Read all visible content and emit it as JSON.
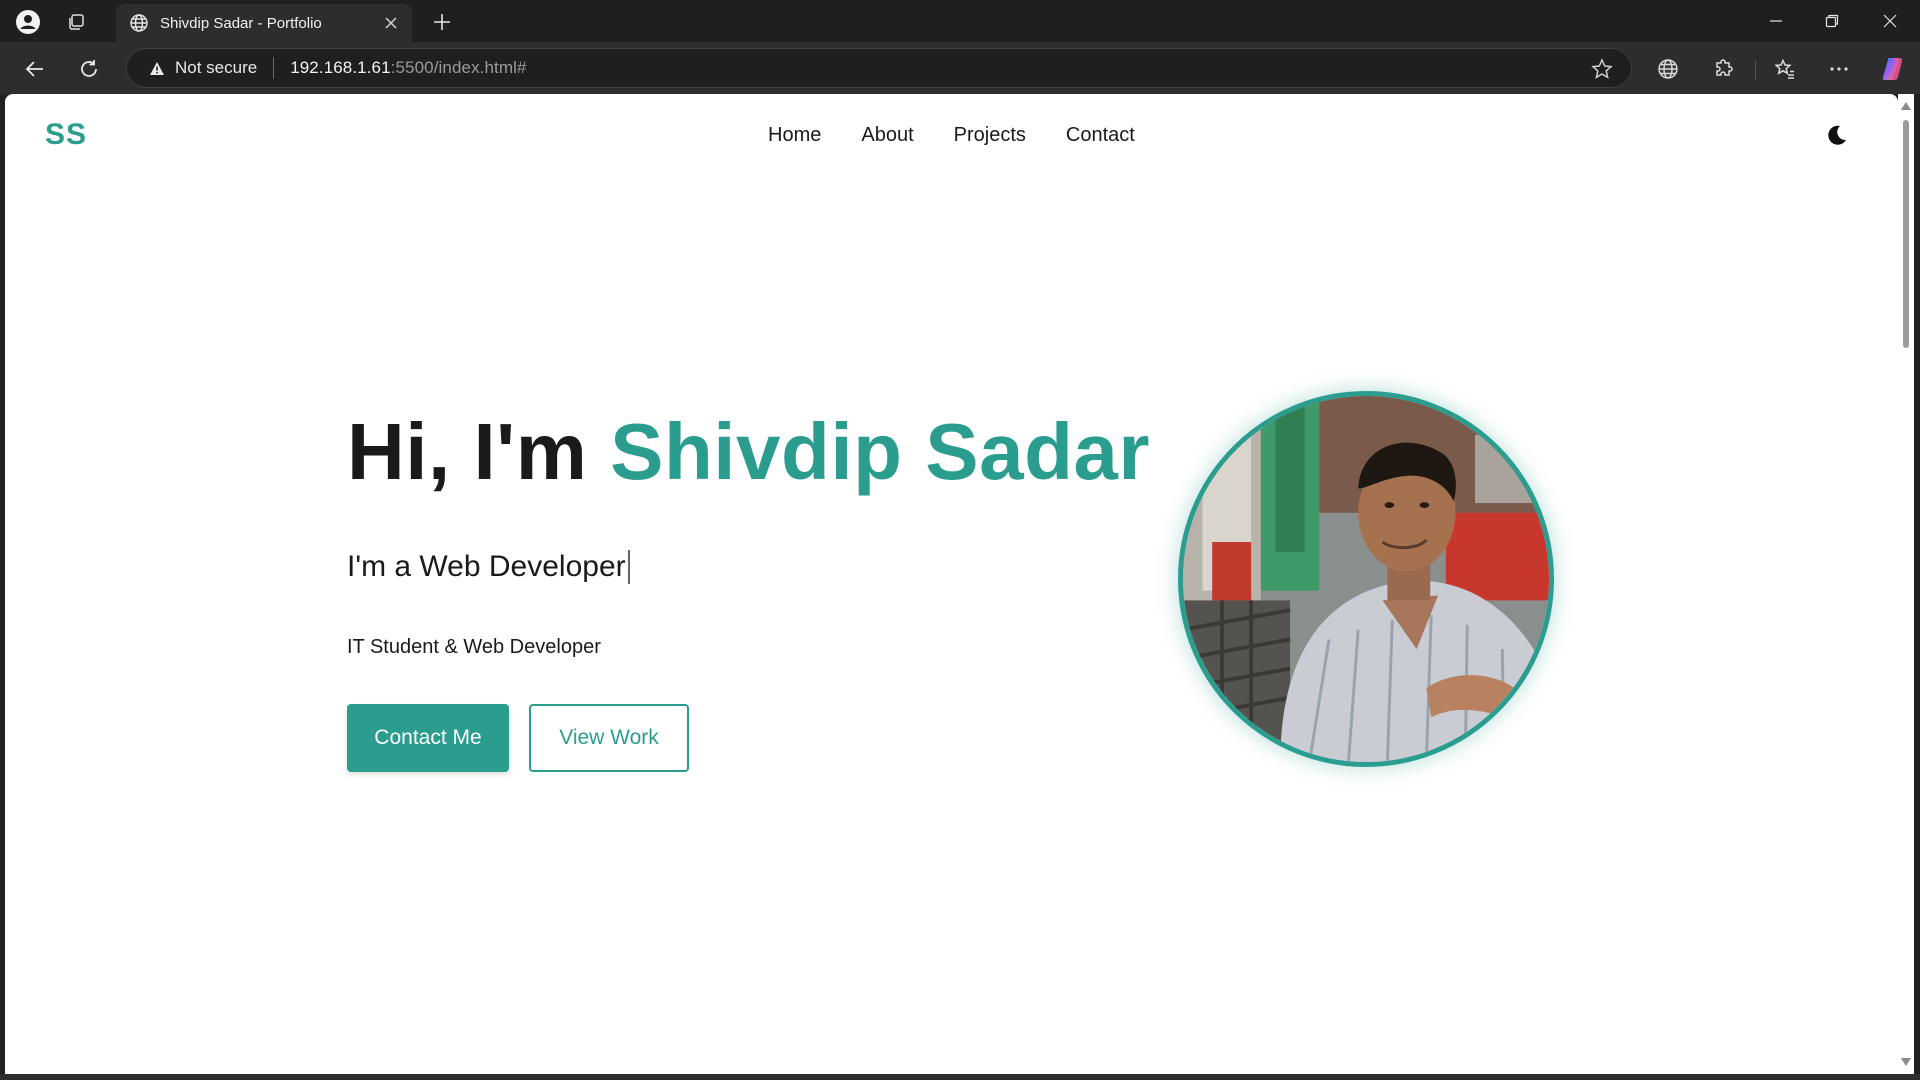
{
  "browser": {
    "tab_title": "Shivdip Sadar - Portfolio",
    "security_label": "Not secure",
    "url_host": "192.168.1.61",
    "url_path": ":5500/index.html#"
  },
  "site": {
    "logo": "SS",
    "nav": [
      "Home",
      "About",
      "Projects",
      "Contact"
    ],
    "hero": {
      "greeting": "Hi, I'm",
      "name": "Shivdip Sadar",
      "typed_text": "I'm a Web Developer",
      "tagline": "IT Student & Web Developer",
      "primary_button": "Contact Me",
      "secondary_button": "View Work"
    },
    "accent_color": "#2a9d8f"
  },
  "icons": {
    "theme_toggle": "moon-icon",
    "avatar": "profile-photo"
  }
}
